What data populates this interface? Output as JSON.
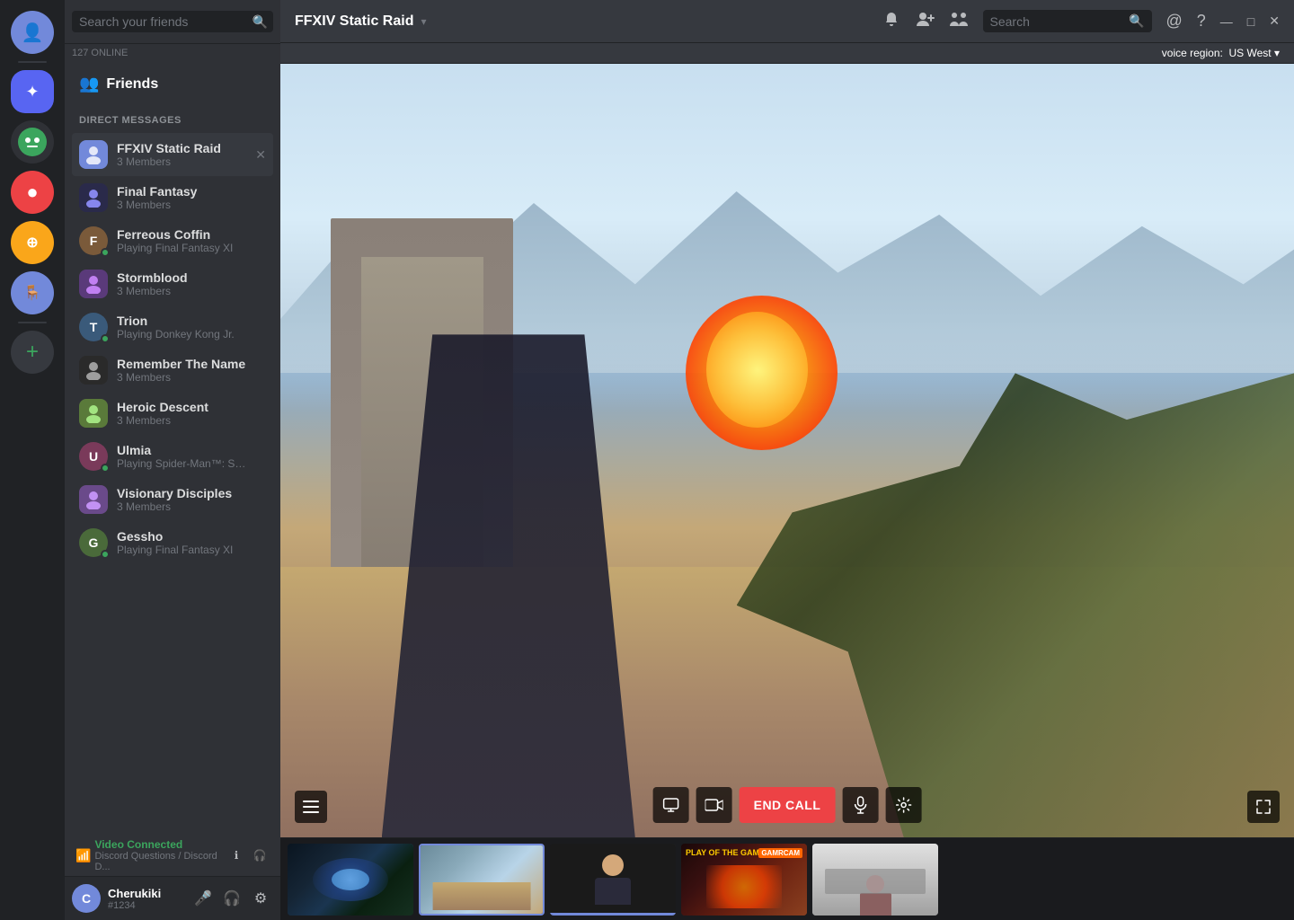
{
  "app": {
    "user_count": "127 ONLINE"
  },
  "servers": [
    {
      "id": "user-avatar",
      "label": "User Avatar",
      "color": "#7289da",
      "letter": "👤"
    },
    {
      "id": "server-1",
      "label": "FFXIV Server",
      "color": "#5865f2",
      "letter": "✦"
    },
    {
      "id": "server-2",
      "label": "Robot Server",
      "color": "#3ba55d",
      "letter": "🤖"
    },
    {
      "id": "server-3",
      "label": "Red Server",
      "color": "#ed4245",
      "letter": "●"
    },
    {
      "id": "server-4",
      "label": "Overwatch Server",
      "color": "#faa61a",
      "letter": "⊕"
    },
    {
      "id": "server-5",
      "label": "Chair Server",
      "color": "#7289da",
      "letter": "🪑"
    }
  ],
  "friends_sidebar": {
    "search_placeholder": "Search your friends",
    "friends_label": "Friends",
    "dm_section_label": "DIRECT MESSAGES",
    "dm_items": [
      {
        "id": "ffxiv-static-raid",
        "name": "FFXIV Static Raid",
        "subtext": "3 Members",
        "type": "group",
        "active": true
      },
      {
        "id": "final-fantasy",
        "name": "Final Fantasy",
        "subtext": "3 Members",
        "type": "group"
      },
      {
        "id": "ferreous-coffin",
        "name": "Ferreous Coffin",
        "subtext": "Playing Final Fantasy XI",
        "type": "user",
        "status": "online"
      },
      {
        "id": "stormblood",
        "name": "Stormblood",
        "subtext": "3 Members",
        "type": "group"
      },
      {
        "id": "trion",
        "name": "Trion",
        "subtext": "Playing Donkey Kong Jr.",
        "type": "user",
        "status": "online"
      },
      {
        "id": "remember-the-name",
        "name": "Remember The Name",
        "subtext": "3 Members",
        "type": "group"
      },
      {
        "id": "heroic-descent",
        "name": "Heroic Descent",
        "subtext": "3 Members",
        "type": "group"
      },
      {
        "id": "ulmia",
        "name": "Ulmia",
        "subtext": "Playing Spider-Man™: Shattered Dimen...",
        "type": "user",
        "status": "online"
      },
      {
        "id": "visionary-disciples",
        "name": "Visionary Disciples",
        "subtext": "3 Members",
        "type": "group"
      },
      {
        "id": "gessho",
        "name": "Gessho",
        "subtext": "Playing Final Fantasy XI",
        "type": "user",
        "status": "online"
      }
    ]
  },
  "topbar": {
    "server_name": "FFXIV Static Raid",
    "dropdown_arrow": "▾",
    "search_placeholder": "Search",
    "icons": {
      "notification": "🔔",
      "add_friend": "👤+",
      "members": "👥",
      "at": "@",
      "help": "?"
    },
    "window_controls": {
      "minimize": "—",
      "maximize": "□",
      "close": "✕"
    }
  },
  "voice_region": {
    "label": "voice region:",
    "region": "US West",
    "dropdown": "▾"
  },
  "video": {
    "end_call_label": "END CALL"
  },
  "thumbnails": [
    {
      "id": "thumb-game1",
      "label": "Game 1 - MOBA"
    },
    {
      "id": "thumb-game2",
      "label": "Game 2 - FPS Active"
    },
    {
      "id": "thumb-game3",
      "label": "Person camera"
    },
    {
      "id": "thumb-game4",
      "label": "Overwatch game"
    },
    {
      "id": "thumb-game5",
      "label": "Person at desk"
    }
  ],
  "voice_status": {
    "connected_label": "Video Connected",
    "channel_path": "Discord Questions / Discord D..."
  },
  "user": {
    "name": "Cherukiki",
    "discriminator": "#1234",
    "avatar_letter": "C",
    "avatar_color": "#7289da"
  }
}
